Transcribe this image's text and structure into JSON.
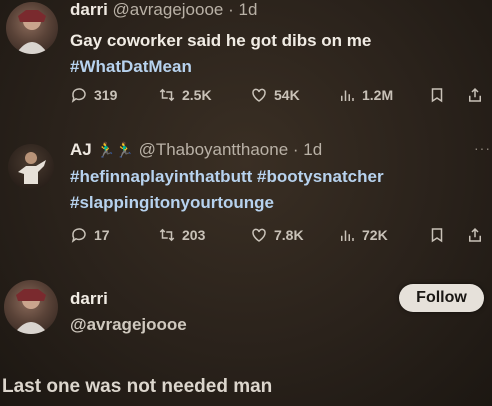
{
  "tweets": [
    {
      "name": "darri",
      "handle": "@avragejoooe",
      "time": "1d",
      "line1": "Gay coworker said he got dibs on me",
      "hashtags": "#WhatDatMean",
      "replies": "319",
      "retweets": "2.5K",
      "likes": "54K",
      "views": "1.2M"
    },
    {
      "name": "AJ",
      "emojis": "🏃‍♂️🏃‍♂️",
      "handle": "@Thaboyantthaone",
      "time": "1d",
      "line1": "#hefinnaplayinthatbutt #bootysnatcher",
      "line2": "#slappingitonyourtounge",
      "replies": "17",
      "retweets": "203",
      "likes": "7.8K",
      "views": "72K"
    }
  ],
  "profile": {
    "name": "darri",
    "handle": "@avragejoooe",
    "follow_label": "Follow"
  },
  "caption": "Last one was not needed man",
  "colors": {
    "hashtag": "#b7d2ee",
    "text": "#f1ece4",
    "muted": "#c9c2b8",
    "follow_bg": "#e6e1da"
  },
  "icons": [
    "reply-icon",
    "retweet-icon",
    "like-icon",
    "views-icon",
    "bookmark-icon",
    "share-icon",
    "more-icon"
  ]
}
